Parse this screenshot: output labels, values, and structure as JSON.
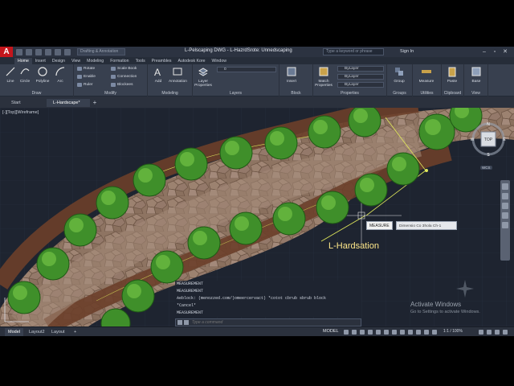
{
  "titlebar": {
    "logo": "A",
    "workspace": "Drafting & Annotation",
    "title": "L-Pelscaping DWG - L-HazrdSrote: Unnedscaping",
    "search_placeholder": "Type a keyword or phrase",
    "sign_in": "Sign In"
  },
  "menu_tabs": [
    "Home",
    "Insert",
    "Design",
    "View",
    "Modeling",
    "Formation",
    "Tools",
    "Preambles",
    "Autodesk Kore",
    "Window"
  ],
  "ribbon": {
    "draw": {
      "label": "Draw",
      "tools": [
        "Line",
        "Circle",
        "Polyline",
        "Arc"
      ]
    },
    "modify": {
      "label": "Modify",
      "tools": [
        "Rotate",
        "Scale Book",
        "Enable",
        "Connection",
        "Ruler",
        "Blockees"
      ]
    },
    "modeling": {
      "label": "Modeling",
      "tools": [
        "Add",
        "Annotation"
      ]
    },
    "layers": {
      "label": "Layers",
      "tools": [
        "Layer Properties"
      ],
      "current": "0"
    },
    "block": {
      "label": "Block",
      "tools": [
        "Insert"
      ]
    },
    "properties": {
      "label": "Properties",
      "tools": [
        "Match Properties"
      ],
      "color": "ByLayer",
      "linetype": "ByLayer",
      "lineweight": "ByLayer"
    },
    "groups": {
      "label": "Groups",
      "tools": [
        "Group"
      ]
    },
    "utilities": {
      "label": "Utilities",
      "tools": [
        "Measure"
      ]
    },
    "clipboard": {
      "label": "Clipboard",
      "tools": [
        "Paste"
      ]
    },
    "view": {
      "label": "View",
      "tools": [
        "Base"
      ]
    }
  },
  "file_tabs": [
    "Start",
    "L-Hardscape*"
  ],
  "canvas": {
    "viewport_label": "[-][Top][Wireframe]",
    "viewcube": {
      "top": "TOP",
      "n": "N",
      "s": "S",
      "e": "E",
      "w": "W",
      "wcs": "WCS"
    },
    "measure_tooltip": "MEASURE",
    "measure_prompt": "Dimensio Co 3hola Ch-1",
    "annotation": "L-Hardsation"
  },
  "command": {
    "history": [
      "MEASUREMENT",
      "MEASUREMENT",
      "Aeblock: (menozzed.com/)omeercervact) *cotot cbrub sbrub block",
      "*Cancel*",
      "MEASUREMENT"
    ],
    "placeholder": "Type a command"
  },
  "watermark": {
    "title": "Activate Windows",
    "subtitle": "Go to Settings to activate Windows."
  },
  "statusbar": {
    "layout_tabs": [
      "Model",
      "Layout2",
      "Layout"
    ],
    "mode": "MODEL",
    "scale": "1:1 / 100%"
  },
  "colors": {
    "canvas_bg": "#1e2430",
    "paving": "#8b7060",
    "shrub": "#3f8f2a",
    "annotation": "#ffe88a",
    "measure_line": "#e0e85a"
  }
}
